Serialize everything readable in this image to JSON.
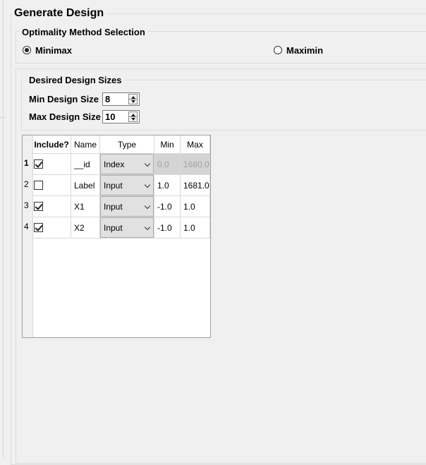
{
  "panel": {
    "title": "Generate Design"
  },
  "optimality": {
    "title": "Optimality Method Selection",
    "options": [
      {
        "label": "Minimax",
        "selected": true
      },
      {
        "label": "Maximin",
        "selected": false
      }
    ]
  },
  "sizes": {
    "title": "Desired Design Sizes",
    "min_label": "Min Design Size",
    "min_value": "8",
    "max_label": "Max Design Size",
    "max_value": "10"
  },
  "table": {
    "headers": [
      "Include?",
      "Name",
      "Type",
      "Min",
      "Max"
    ],
    "rows": [
      {
        "num": "1",
        "checked": true,
        "name": "__id",
        "type": "Index",
        "min": "0.0",
        "max": "1680.0",
        "disabled": true
      },
      {
        "num": "2",
        "checked": false,
        "name": "Label",
        "type": "Input",
        "min": "1.0",
        "max": "1681.0",
        "disabled": false
      },
      {
        "num": "3",
        "checked": true,
        "name": "X1",
        "type": "Input",
        "min": "-1.0",
        "max": "1.0",
        "disabled": false
      },
      {
        "num": "4",
        "checked": true,
        "name": "X2",
        "type": "Input",
        "min": "-1.0",
        "max": "1.0",
        "disabled": false
      }
    ]
  }
}
